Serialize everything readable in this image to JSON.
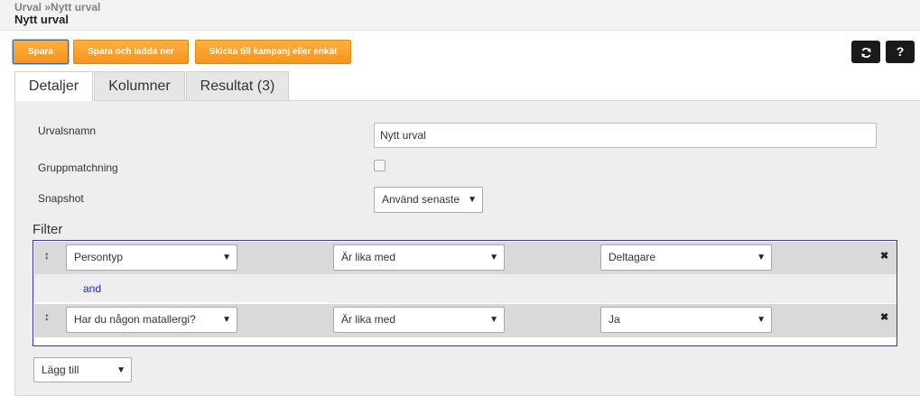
{
  "header": {
    "breadcrumb": "Urval »Nytt urval",
    "title": "Nytt urval"
  },
  "toolbar": {
    "save_label": "Spara",
    "save_download_label": "Spara och ladda ner",
    "send_label": "Skicka till kampanj eller enkät",
    "refresh_icon": "refresh-icon",
    "help_label": "?"
  },
  "tabs": [
    {
      "label": "Detaljer",
      "active": true
    },
    {
      "label": "Kolumner",
      "active": false
    },
    {
      "label": "Resultat (3)",
      "active": false
    }
  ],
  "form": {
    "name_label": "Urvalsnamn",
    "name_value": "Nytt urval",
    "group_label": "Gruppmatchning",
    "group_checked": false,
    "snapshot_label": "Snapshot",
    "snapshot_value": "Använd senaste"
  },
  "filter": {
    "title": "Filter",
    "connector": "and",
    "rows": [
      {
        "field": "Persontyp",
        "operator": "Är lika med",
        "value": "Deltagare"
      },
      {
        "field": "Har du någon matallergi?",
        "operator": "Är lika med",
        "value": "Ja"
      }
    ],
    "add_label": "Lägg till"
  },
  "colors": {
    "orange": "#f7941d",
    "filter_border": "#3333cc",
    "and_text": "#2222cc"
  }
}
